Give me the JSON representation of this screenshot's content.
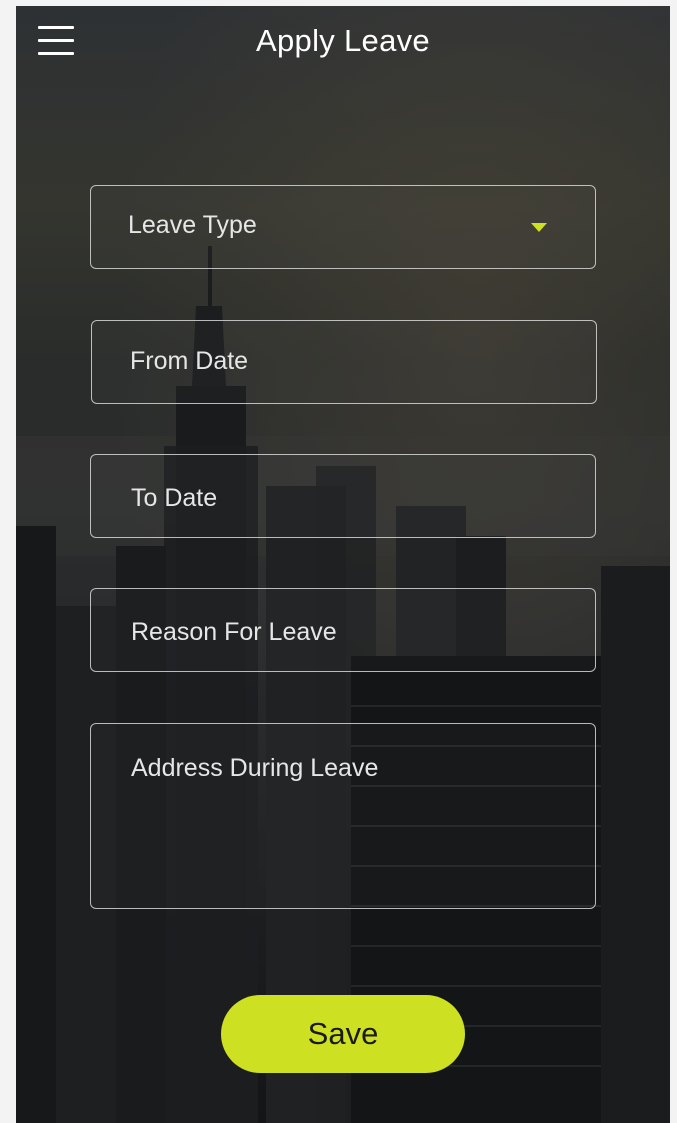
{
  "header": {
    "title": "Apply Leave",
    "menu_icon": "hamburger-menu-icon"
  },
  "form": {
    "leave_type": {
      "placeholder": "Leave Type",
      "icon": "dropdown-arrow-icon"
    },
    "from_date": {
      "placeholder": "From Date"
    },
    "to_date": {
      "placeholder": "To Date"
    },
    "reason": {
      "placeholder": "Reason For Leave"
    },
    "address": {
      "placeholder": "Address During Leave"
    }
  },
  "actions": {
    "save_label": "Save"
  },
  "colors": {
    "accent": "#cde022",
    "text": "#ffffff",
    "field_border": "#d7d7d7"
  }
}
